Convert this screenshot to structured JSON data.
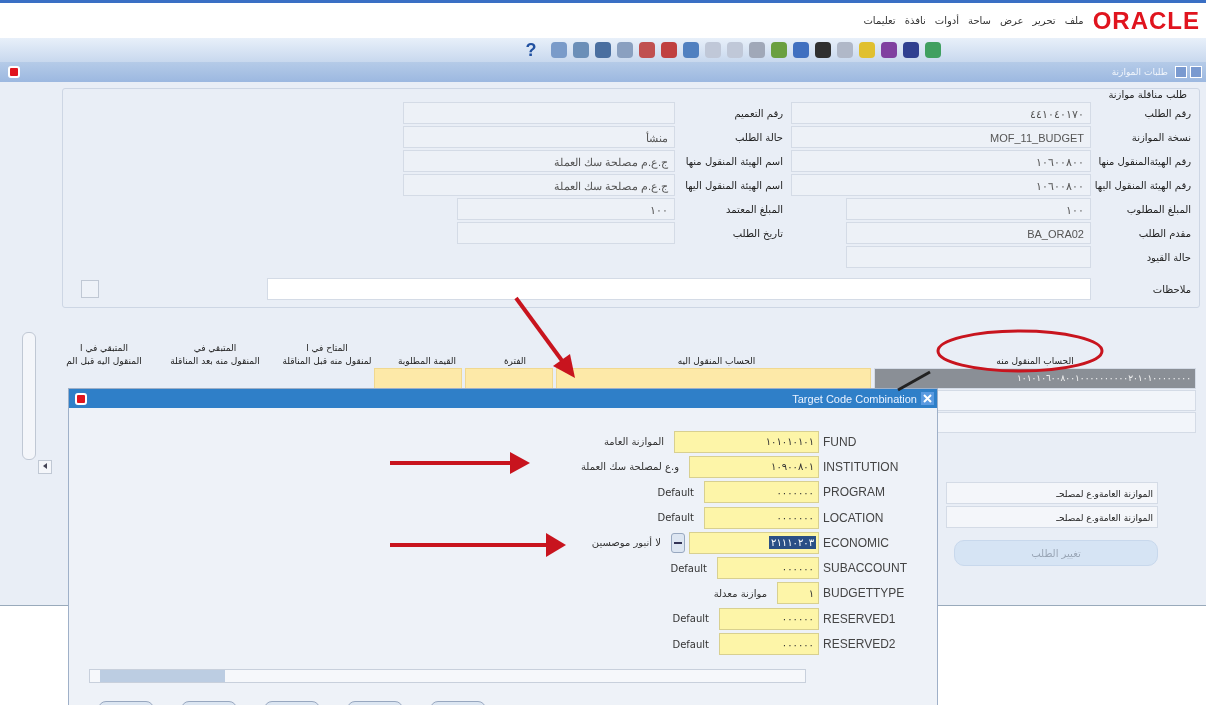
{
  "menu": {
    "brand": "ORACLE",
    "items": [
      "ملف",
      "تحرير",
      "عرض",
      "ساحة",
      "أدوات",
      "نافذة",
      "تعليمات"
    ]
  },
  "toolbar": {
    "help": "?"
  },
  "window": {
    "title": "طلبات الموازنة"
  },
  "form": {
    "heading": "طلب مناقلة موازنة",
    "right_fields": [
      {
        "label": "رقم الطلب",
        "value": "٤٤١٠٤٠١٧٠"
      },
      {
        "label": "نسخة الموازنة",
        "value": "MOF_11_BUDGET"
      },
      {
        "label": "رقم الهيئةالمنقول منها",
        "value": "١٠٦٠٠٨٠٠"
      },
      {
        "label": "رقم الهيئة المنقول اليها",
        "value": "١٠٦٠٠٨٠٠"
      },
      {
        "label": "المبلغ المطلوب",
        "value": "١٠٠"
      },
      {
        "label": "مقدم الطلب",
        "value": "BA_ORA02"
      },
      {
        "label": "حالة القيود"
      }
    ],
    "left_fields": [
      {
        "label": "رقم التعميم"
      },
      {
        "label": "حالة الطلب",
        "value": "منشأ"
      },
      {
        "label": "اسم الهيئة المنقول منها",
        "value": "ج.ع.م مصلحة سك العملة"
      },
      {
        "label": "اسم الهيئة المنقول اليها",
        "value": "ج.ع.م مصلحة سك العملة"
      },
      {
        "label": "المبلغ المعتمد",
        "value": "١٠٠"
      },
      {
        "label": "تاريخ الطلب"
      }
    ],
    "notes": {
      "label": "ملاحظات"
    },
    "checkbox": {
      "checked": false
    }
  },
  "table": {
    "columns": [
      {
        "lines": [
          "الحساب المنقول منه"
        ]
      },
      {
        "lines": [
          "الحساب المنقول اليه"
        ]
      },
      {
        "lines": [
          "الفترة"
        ]
      },
      {
        "lines": [
          "القيمة المطلوبة"
        ]
      },
      {
        "lines": [
          "المتاح في ا",
          "لمنقول منه قبل المناقلة"
        ]
      },
      {
        "lines": [
          "المتبقي في",
          "المنقول منه بعد المناقلة"
        ]
      },
      {
        "lines": [
          "المتبقي في ا",
          "المنقول اليه قبل الم"
        ]
      }
    ],
    "rows": [
      {
        "from_account": "١٠١٠١٠٦٠٠٨٠٠١٠٠٠٠٠٠٠٠٠٠٢٠١٠١٠٠٠٠٠٠٠٠",
        "selected": true
      }
    ]
  },
  "summary_fields": [
    "الموازنة العامةو.ع لمصلحـ",
    "الموازنة العامةو.ع لمصلحـ"
  ],
  "change_button": {
    "label": "تغيير الطلب",
    "disabled": true
  },
  "dialog": {
    "title": "Target Code Combination",
    "segments": [
      {
        "description": "الموازنة العامة",
        "value": "١٠١٠١٠١٠١",
        "name": "FUND",
        "kind": "plain",
        "selected": false
      },
      {
        "description": "و.ع لمصلحة سك العملة",
        "value": "١٠٩٠٠٨٠١",
        "name": "INSTITUTION",
        "kind": "plain",
        "selected": false
      },
      {
        "description": "Default",
        "value": "٠٠٠٠٠٠٠",
        "name": "PROGRAM",
        "kind": "plain",
        "selected": false
      },
      {
        "description": "Default",
        "value": "٠٠٠٠٠٠٠",
        "name": "LOCATION",
        "kind": "plain",
        "selected": false
      },
      {
        "description": "لا أنبور موصسين",
        "value": "٢١١١٠٢٠٣",
        "name": "ECONOMIC",
        "kind": "list",
        "selected": true
      },
      {
        "description": "Default",
        "value": "٠٠٠٠٠٠",
        "name": "SUBACCOUNT",
        "kind": "plain",
        "selected": false
      },
      {
        "description": "موازنة معدلة",
        "value": "١",
        "name": "BUDGETTYPE",
        "kind": "plain",
        "selected": false
      },
      {
        "description": "Default",
        "value": "٠٠٠٠٠٠",
        "name": "RESERVED1",
        "kind": "plain",
        "selected": false
      },
      {
        "description": "Default",
        "value": "٠٠٠٠٠٠",
        "name": "RESERVED2",
        "kind": "plain",
        "selected": false
      }
    ]
  }
}
